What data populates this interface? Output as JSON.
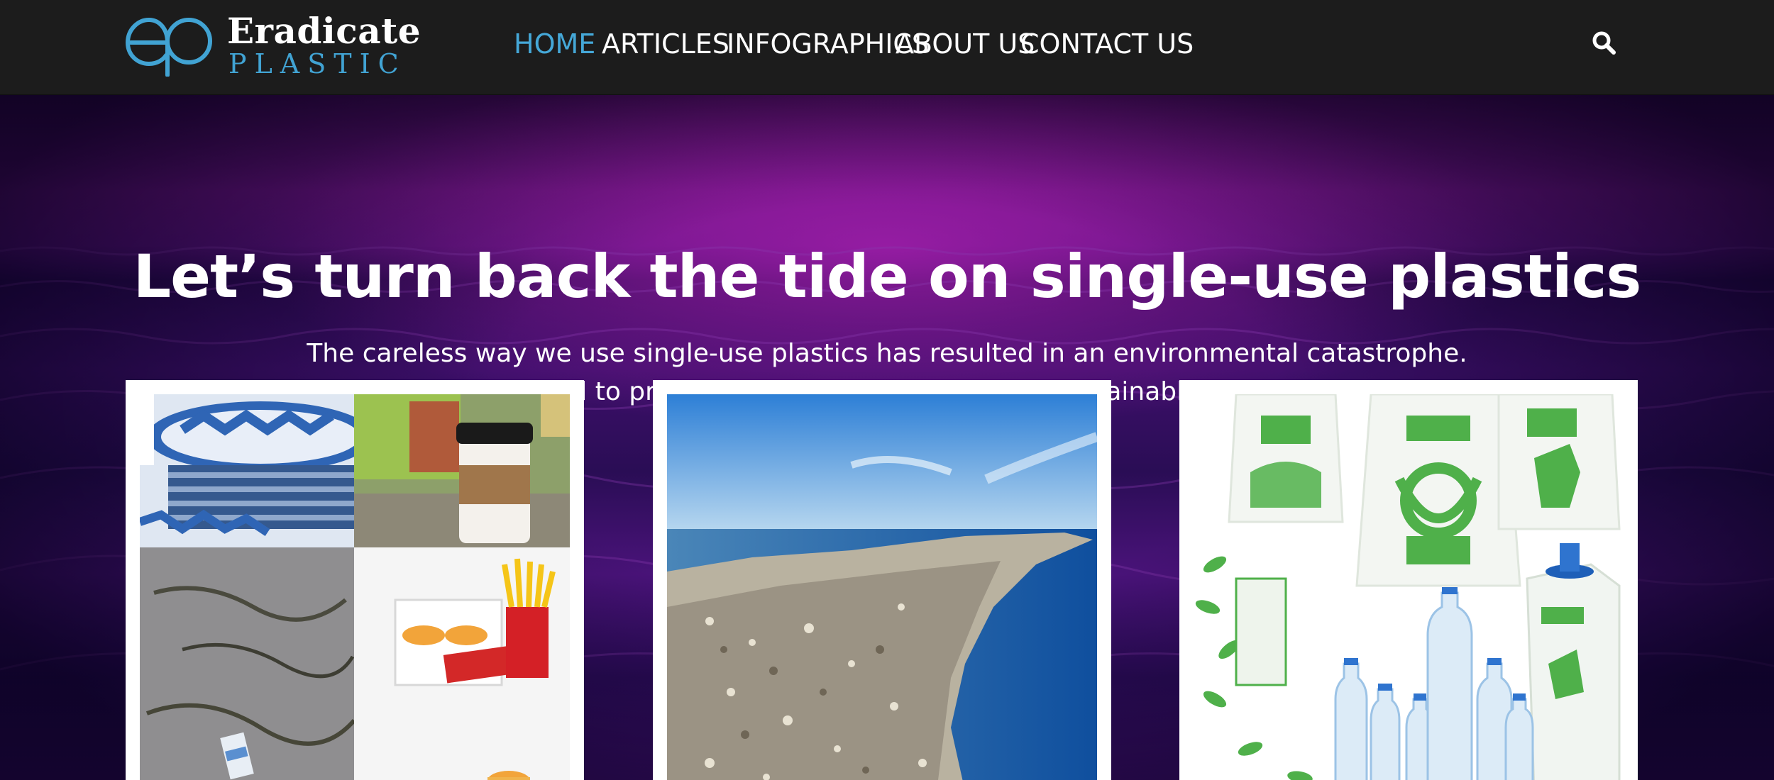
{
  "brand": {
    "name_line1": "Eradicate",
    "name_line2": "PLASTIC",
    "accent_color": "#41a3d3",
    "logo_icon": "ep-monogram-icon"
  },
  "nav": {
    "items": [
      {
        "label": "HOME",
        "active": true
      },
      {
        "label": "ARTICLES",
        "active": false
      },
      {
        "label": "INFOGRAPHICS",
        "active": false
      },
      {
        "label": "ABOUT US",
        "active": false
      },
      {
        "label": "CONTACT US",
        "active": false
      }
    ],
    "active_color": "#45a8d8",
    "search_icon": "search-icon"
  },
  "hero": {
    "title": "Let’s turn back the tide on single-use plastics",
    "subtitle_line1": "The careless way we use single-use plastics has resulted in an environmental catastrophe.",
    "subtitle_line2": "This blog is dedicated to providing information on living a sustainable life with less plastic."
  },
  "cards": [
    {
      "image": "single-use-items-collage"
    },
    {
      "image": "ocean-plastic-garbage-patch"
    },
    {
      "image": "save-earth-bags-and-bottles"
    }
  ]
}
